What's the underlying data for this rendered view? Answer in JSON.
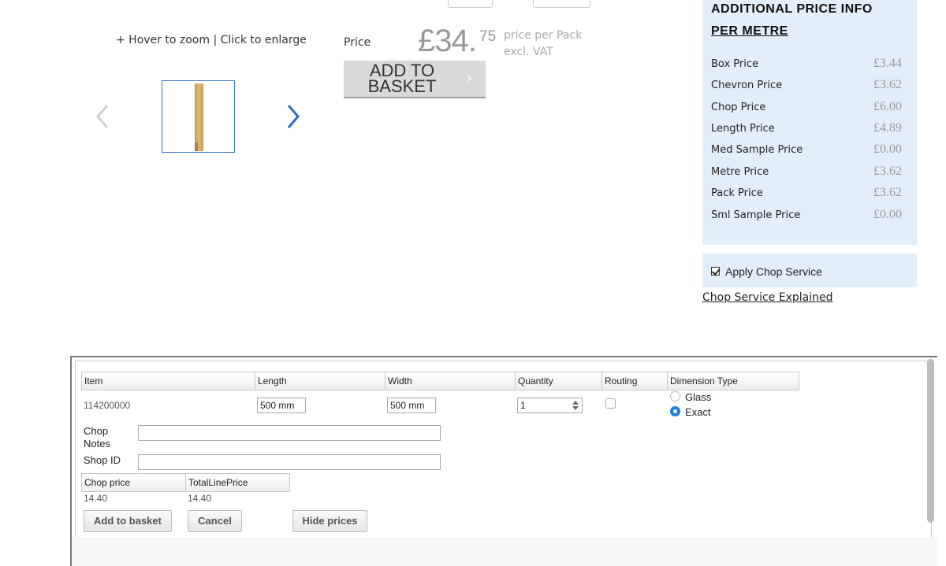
{
  "gallery": {
    "zoom_hint": "+ Hover to zoom | Click to enlarge"
  },
  "purchase": {
    "price_label": "Price",
    "price_main": "£34.",
    "price_pence": "75",
    "price_per_line1": "price per Pack",
    "price_per_line2": "excl. VAT",
    "add_to_basket": "ADD TO BASKET",
    "add_to_basket_chevron": "›"
  },
  "price_info": {
    "title": "ADDITIONAL PRICE INFO",
    "subtitle": "PER  METRE",
    "rows": [
      {
        "label": "Box Price",
        "value": "£3.44"
      },
      {
        "label": "Chevron Price",
        "value": "£3.62"
      },
      {
        "label": "Chop Price",
        "value": "£6.00"
      },
      {
        "label": "Length Price",
        "value": "£4.89"
      },
      {
        "label": "Med Sample Price",
        "value": "£0.00"
      },
      {
        "label": "Metre Price",
        "value": "£3.62"
      },
      {
        "label": "Pack Price",
        "value": "£3.62"
      },
      {
        "label": "Sml Sample Price",
        "value": "£0.00"
      }
    ]
  },
  "chop_service": {
    "apply_label": "Apply Chop Service",
    "checked": true,
    "explained_link": "Chop Service Explained"
  },
  "chop_form": {
    "headers": {
      "item": "Item",
      "length": "Length",
      "width": "Width",
      "quantity": "Quantity",
      "routing": "Routing",
      "dimension_type": "Dimension Type"
    },
    "item_value": "114200000",
    "length_value": "500 mm",
    "width_value": "500 mm",
    "quantity_value": "1",
    "routing_checked": false,
    "dimension_options": [
      "Glass",
      "Exact"
    ],
    "dimension_selected": "Exact",
    "chop_notes_label": "Chop Notes",
    "chop_notes_value": "",
    "shop_id_label": "Shop ID",
    "shop_id_value": "",
    "chop_price_header": "Chop price",
    "total_line_price_header": "TotalLinePrice",
    "chop_price_value": "14.40",
    "total_line_price_value": "14.40",
    "buttons": {
      "add": "Add to basket",
      "cancel": "Cancel",
      "hide_prices": "Hide prices"
    }
  },
  "colors": {
    "panel_bg": "#e3eefb",
    "accent_blue": "#1e7de1",
    "price_grey": "#999999"
  }
}
